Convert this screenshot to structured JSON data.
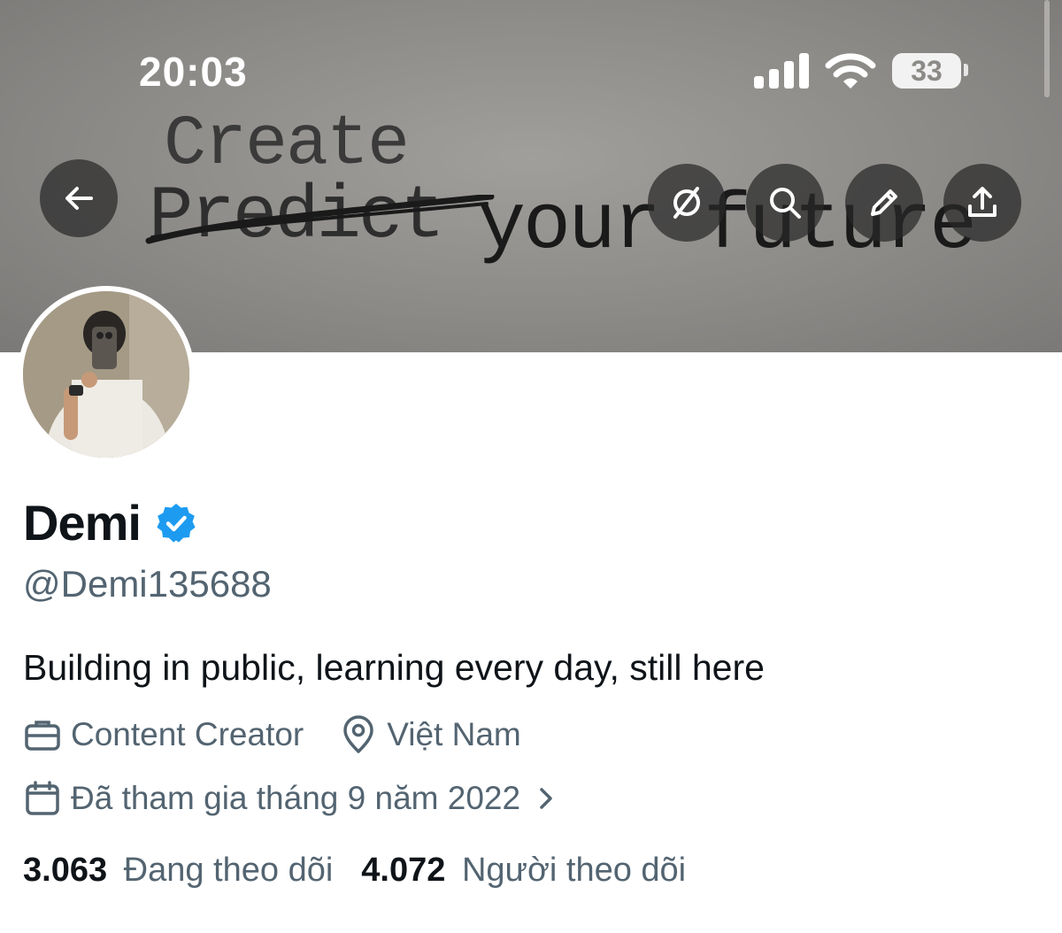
{
  "status_bar": {
    "time": "20:03",
    "battery": "33",
    "icons": [
      "signal-icon",
      "wifi-icon",
      "battery-icon"
    ]
  },
  "banner": {
    "line1": "Create",
    "line2_struck": "Predict",
    "line2_rest": "your future"
  },
  "toolbar": {
    "icons": [
      "back-arrow-icon",
      "grok-icon",
      "search-icon",
      "edit-icon",
      "share-icon"
    ]
  },
  "profile": {
    "name": "Demi",
    "handle": "@Demi135688",
    "bio": "Building in public, learning every day, still here",
    "category": "Content Creator",
    "location": "Việt Nam",
    "joined": "Đã tham gia tháng 9 năm 2022",
    "following_count": "3.063",
    "following_label": "Đang theo dõi",
    "followers_count": "4.072",
    "followers_label": "Người theo dõi"
  },
  "colors": {
    "verified": "#1d9bf0",
    "muted_text": "#536471",
    "primary_text": "#0f1419"
  }
}
